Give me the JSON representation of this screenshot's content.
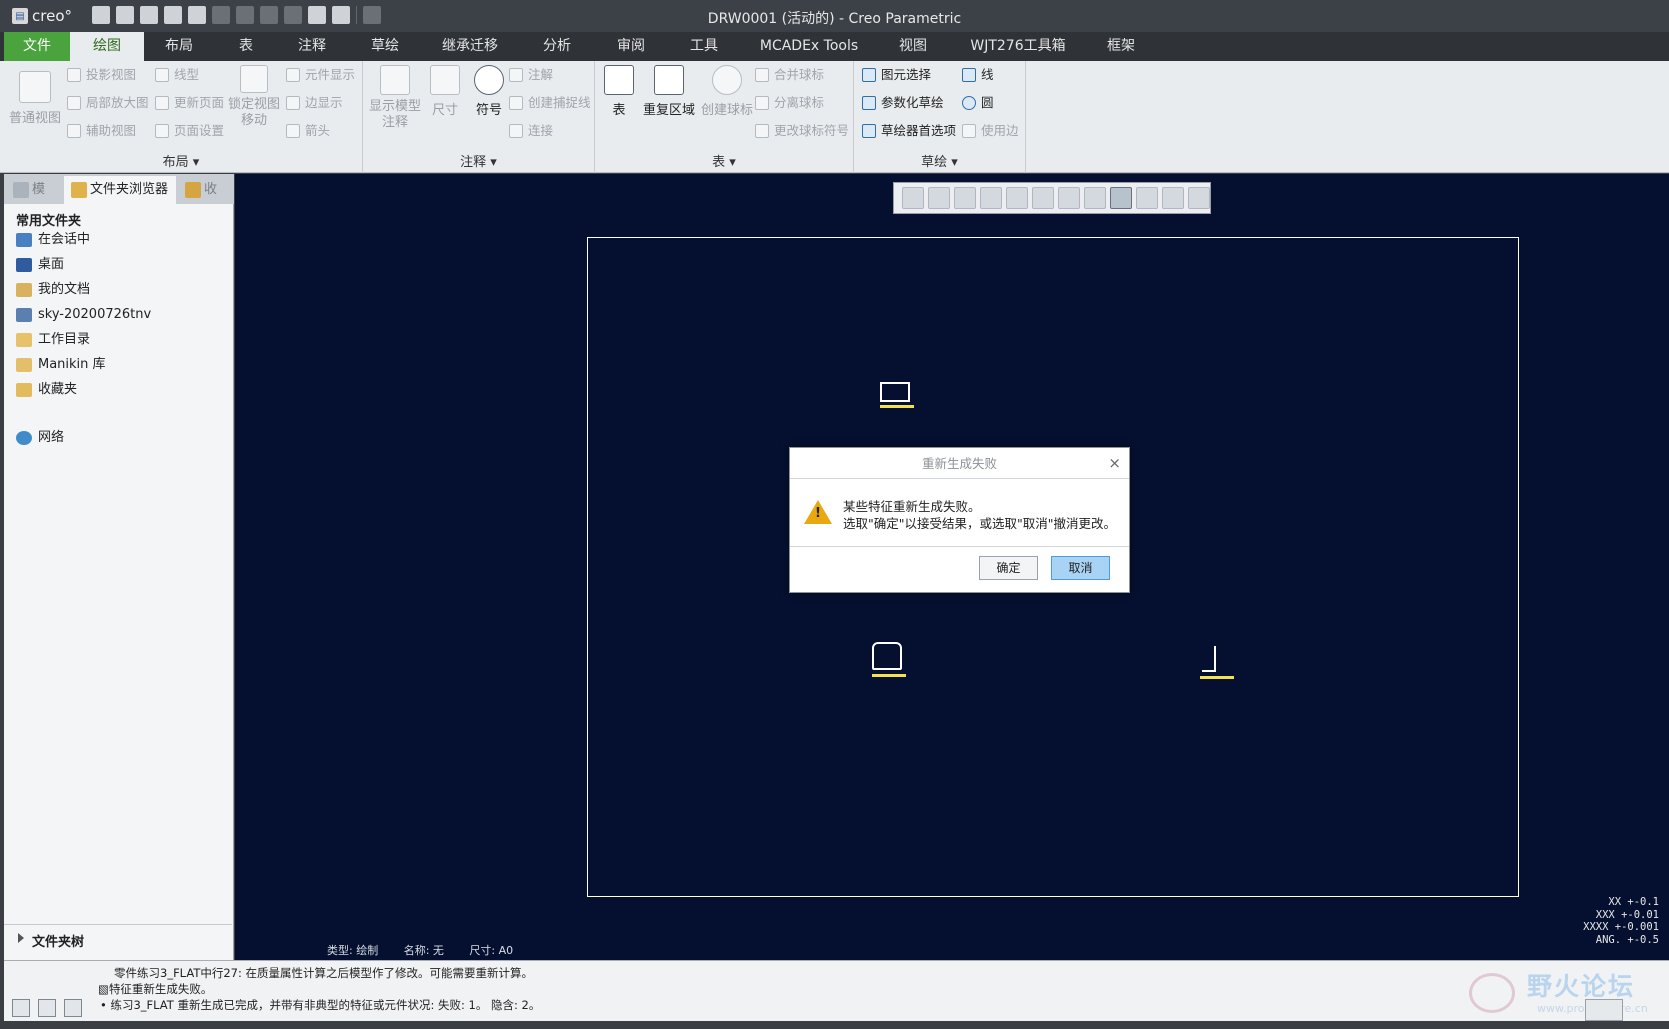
{
  "window": {
    "title": "DRW0001 (活动的) - Creo Parametric",
    "app_logo": "creo°"
  },
  "quick_access": {
    "icons": [
      "new-icon",
      "open-icon",
      "save-icon",
      "save-as-icon",
      "print-icon",
      "undo-icon",
      "redo-icon",
      "select-box-icon",
      "regen-icon",
      "windows-icon",
      "close-window-icon",
      "customize-icon"
    ]
  },
  "ribbon": {
    "tabs": [
      "文件",
      "绘图",
      "布局",
      "表",
      "注释",
      "草绘",
      "继承迁移",
      "分析",
      "审阅",
      "工具",
      "MCADEx Tools",
      "视图",
      "WJT276工具箱",
      "框架"
    ],
    "active_tab": "绘图",
    "groups": {
      "layout": {
        "label": "布局",
        "big": "普通视图",
        "col1": [
          "投影视图",
          "局部放大图",
          "辅助视图"
        ],
        "col2": [
          "线型",
          "更新页面",
          "页面设置"
        ],
        "lock": "锁定视图移动",
        "col3": [
          "元件显示",
          "边显示",
          "箭头"
        ]
      },
      "annotation": {
        "label": "注释",
        "show_model": "显示模型注释",
        "dimension": "尺寸",
        "symbol": "符号",
        "col": [
          "注解",
          "创建捕捉线",
          "连接"
        ]
      },
      "table": {
        "label": "表",
        "table": "表",
        "repeat": "重复区域",
        "balloon": "创建球标",
        "col": [
          "合并球标",
          "分离球标",
          "更改球标符号"
        ]
      },
      "sketch": {
        "label": "草绘",
        "col1": [
          "图元选择",
          "参数化草绘",
          "草绘器首选项"
        ],
        "col2": [
          "线",
          "圆",
          "使用边"
        ]
      }
    }
  },
  "left_panel": {
    "tabs": [
      "模",
      "文件夹浏览器",
      "收"
    ],
    "fav_title": "常用文件夹",
    "favorites": [
      "在会话中",
      "桌面",
      "我的文档",
      "sky-20200726tnv",
      "工作目录",
      "Manikin 库",
      "收藏夹"
    ],
    "network": "网络",
    "folder_tree": "文件夹树"
  },
  "graphics": {
    "sheet_info": {
      "type": "类型: 绘制",
      "name": "名称: 无",
      "size": "尺寸: A0"
    },
    "tolerance": [
      "XX   +-0.1",
      "XXX   +-0.01",
      "XXXX  +-0.001",
      "ANG.  +-0.5"
    ]
  },
  "dialog": {
    "title": "重新生成失败",
    "message1": "某些特征重新生成失败。",
    "message2": "选取\"确定\"以接受结果，或选取\"取消\"撤消更改。",
    "ok": "确定",
    "cancel": "取消"
  },
  "status": {
    "line1": "零件练习3_FLAT中行27: 在质量属性计算之后模型作了修改。可能需要重新计算。",
    "line2": "特征重新生成失败。",
    "line3": "练习3_FLAT 重新生成已完成，并带有非典型的特征或元件状况: 失败: 1。 隐含: 2。"
  },
  "watermark": {
    "text": "野火论坛",
    "url": "www.proewildfire.cn"
  }
}
